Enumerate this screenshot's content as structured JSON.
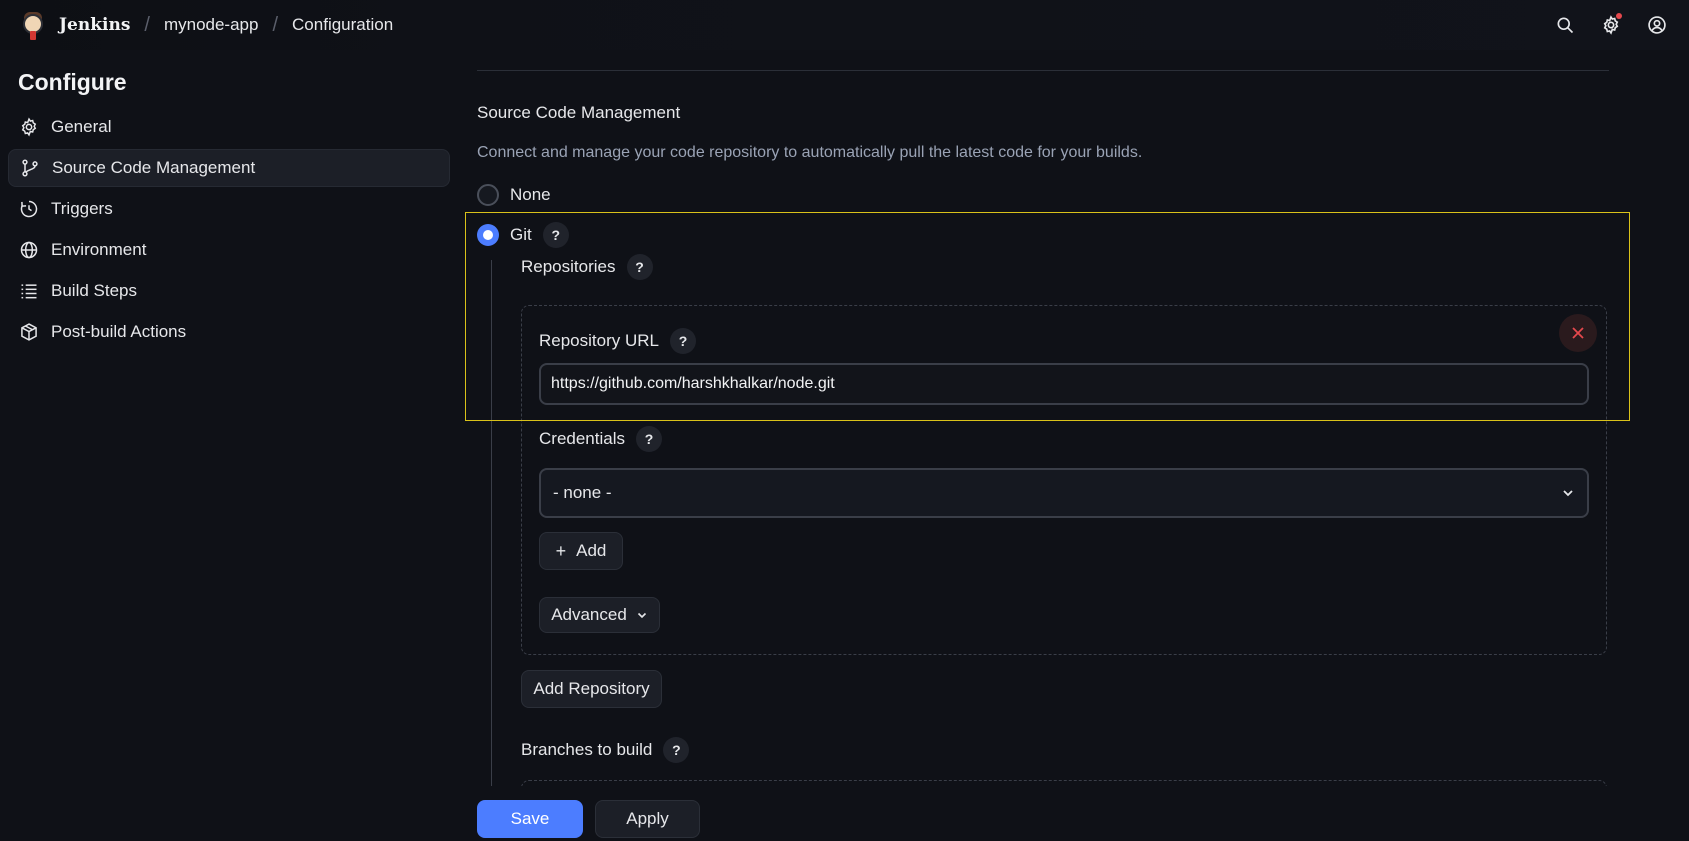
{
  "header": {
    "brand": "Jenkins",
    "breadcrumbs": [
      "mynode-app",
      "Configuration"
    ],
    "separator": "/",
    "icons": [
      "search-icon",
      "gear-icon",
      "user-icon"
    ]
  },
  "sidebar": {
    "title": "Configure",
    "items": [
      {
        "label": "General",
        "icon": "gear-icon",
        "active": false
      },
      {
        "label": "Source Code Management",
        "icon": "git-branch-icon",
        "active": true
      },
      {
        "label": "Triggers",
        "icon": "clock-icon",
        "active": false
      },
      {
        "label": "Environment",
        "icon": "globe-icon",
        "active": false
      },
      {
        "label": "Build Steps",
        "icon": "list-icon",
        "active": false
      },
      {
        "label": "Post-build Actions",
        "icon": "package-icon",
        "active": false
      }
    ]
  },
  "scm": {
    "title": "Source Code Management",
    "description": "Connect and manage your code repository to automatically pull the latest code for your builds.",
    "options": [
      {
        "label": "None",
        "checked": false
      },
      {
        "label": "Git",
        "checked": true
      }
    ],
    "help": "?",
    "repositories_label": "Repositories",
    "repository_url_label": "Repository URL",
    "repository_url_value": "https://github.com/harshkhalkar/node.git",
    "credentials_label": "Credentials",
    "credentials_value": "- none -",
    "add_label": "Add",
    "advanced_label": "Advanced",
    "add_repository_label": "Add Repository",
    "branches_label": "Branches to build"
  },
  "footer": {
    "save_label": "Save",
    "apply_label": "Apply"
  },
  "colors": {
    "accent": "#4c7dff",
    "highlight": "#d9c21a",
    "danger": "#e5484d"
  }
}
